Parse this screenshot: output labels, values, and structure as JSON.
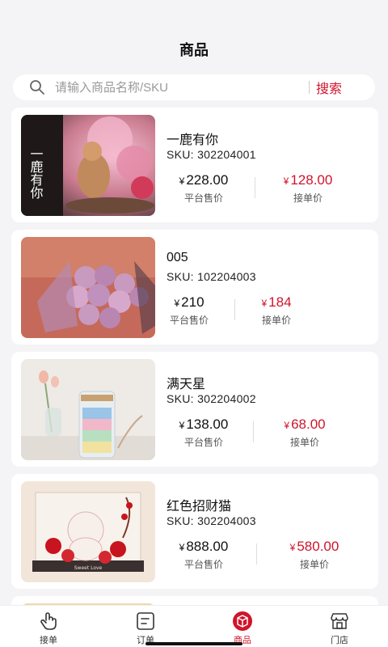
{
  "header": {
    "title": "商品"
  },
  "search": {
    "placeholder": "请输入商品名称/SKU",
    "button_label": "搜索"
  },
  "products": [
    {
      "name": "一鹿有你",
      "sku": "SKU:  302204001",
      "platform_price": "228.00",
      "order_price": "128.00",
      "overlay_text": "一鹿有你"
    },
    {
      "name": "005",
      "sku": "SKU:  102204003",
      "platform_price": "210",
      "order_price": "184"
    },
    {
      "name": "满天星",
      "sku": "SKU:  302204002",
      "platform_price": "138.00",
      "order_price": "68.00"
    },
    {
      "name": "红色招财猫",
      "sku": "SKU:  302204003",
      "platform_price": "888.00",
      "order_price": "580.00",
      "overlay_text": "Sweet Love"
    }
  ],
  "labels": {
    "currency": "¥",
    "platform_price": "平台售价",
    "order_price": "接单价"
  },
  "tabbar": [
    {
      "label": "接单",
      "icon": "hand-pointer-icon",
      "active": false
    },
    {
      "label": "订单",
      "icon": "order-list-icon",
      "active": false
    },
    {
      "label": "商品",
      "icon": "product-box-icon",
      "active": true
    },
    {
      "label": "门店",
      "icon": "store-icon",
      "active": false
    }
  ],
  "colors": {
    "accent": "#d0142c",
    "background": "#f4f4f6"
  }
}
